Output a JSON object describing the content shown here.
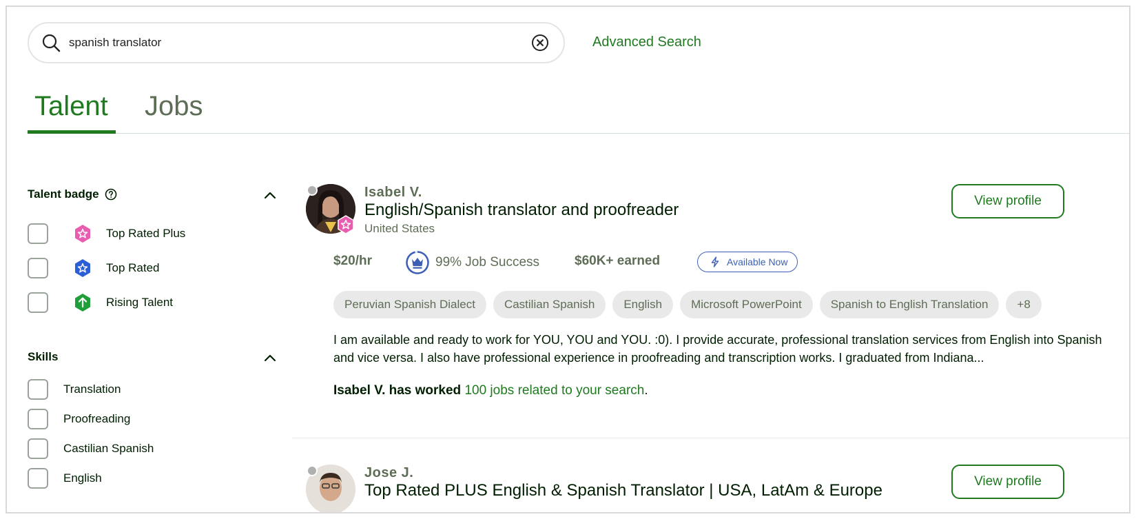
{
  "search": {
    "value": "spanish translator",
    "advanced_label": "Advanced Search"
  },
  "tabs": [
    {
      "label": "Talent"
    },
    {
      "label": "Jobs"
    }
  ],
  "sidebar": {
    "talent_badge": {
      "title": "Talent badge",
      "options": [
        {
          "label": "Top Rated Plus",
          "icon": "top-rated-plus-icon",
          "color": "#e85db0"
        },
        {
          "label": "Top Rated",
          "icon": "top-rated-icon",
          "color": "#2c5fd6"
        },
        {
          "label": "Rising Talent",
          "icon": "rising-talent-icon",
          "color": "#1f9e3a"
        }
      ]
    },
    "skills": {
      "title": "Skills",
      "options": [
        {
          "label": "Translation"
        },
        {
          "label": "Proofreading"
        },
        {
          "label": "Castilian Spanish"
        },
        {
          "label": "English"
        }
      ]
    }
  },
  "results": [
    {
      "name": "Isabel V.",
      "headline": "English/Spanish translator and proofreader",
      "location": "United States",
      "rate": "$20/hr",
      "job_success": "99% Job Success",
      "earned": "$60K+ earned",
      "availability": "Available Now",
      "skills": [
        "Peruvian Spanish Dialect",
        "Castilian Spanish",
        "English",
        "Microsoft PowerPoint",
        "Spanish to English Translation",
        "+8"
      ],
      "description": "I am available and ready to work for YOU, YOU and YOU. :0). I provide accurate, professional translation services from English into Spanish and vice versa. I also have professional experience in proofreading and transcription works. I graduated from Indiana...",
      "worked_prefix": "Isabel V. has worked",
      "worked_link": "100 jobs related to your search",
      "worked_suffix": ".",
      "view_label": "View profile"
    },
    {
      "name": "Jose J.",
      "headline": "Top Rated PLUS English & Spanish Translator | USA, LatAm & Europe",
      "view_label": "View profile"
    }
  ],
  "colors": {
    "accent": "#1f7a1f",
    "available_blue": "#3c5fb5"
  }
}
